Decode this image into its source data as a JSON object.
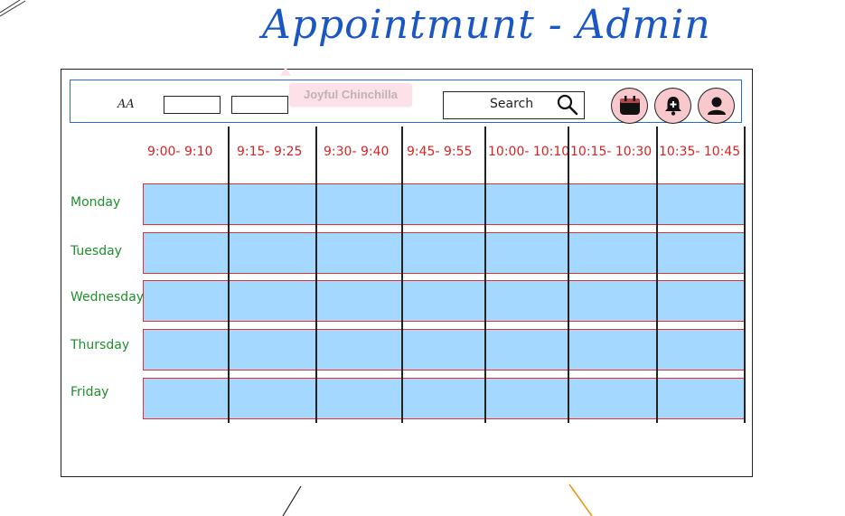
{
  "page_title": "Appointmunt - Admin",
  "header": {
    "aa_label": "AA",
    "sticky_note": "Joyful Chinchilla",
    "search_label": "Search"
  },
  "icons": {
    "calendar": "calendar-icon",
    "notifications": "bell-icon",
    "profile": "user-icon",
    "search": "search-icon"
  },
  "time_slots": [
    "9:00- 9:10",
    "9:15- 9:25",
    "9:30- 9:40",
    "9:45- 9:55",
    "10:00- 10:10",
    "10:15- 10:30",
    "10:35- 10:45"
  ],
  "days": [
    "Monday",
    "Tuesday",
    "Wednesday",
    "Thursday",
    "Friday"
  ],
  "colors": {
    "title": "#1a56c4",
    "time_labels": "#d42424",
    "day_labels": "#1f8f2c",
    "slot_fill": "#a5d8ff",
    "slot_border": "#e03131",
    "icon_button_fill": "#f8c8cc"
  }
}
